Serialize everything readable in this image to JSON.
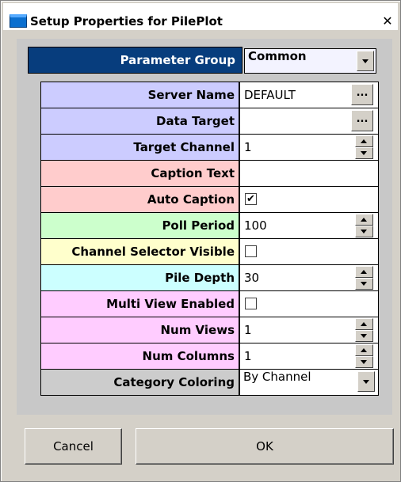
{
  "window": {
    "title": "Setup Properties for PilePlot",
    "close_glyph": "✕"
  },
  "parameter_group": {
    "label": "Parameter Group",
    "value": "Common"
  },
  "rows": [
    {
      "label": "Server Name",
      "value": "DEFAULT",
      "control": "ellipsis",
      "color": "#ccccff"
    },
    {
      "label": "Data Target",
      "value": "",
      "control": "ellipsis",
      "color": "#ccccff"
    },
    {
      "label": "Target Channel",
      "value": "1",
      "control": "spin",
      "color": "#ccccff"
    },
    {
      "label": "Caption Text",
      "value": "",
      "control": "text",
      "color": "#ffcccc"
    },
    {
      "label": "Auto Caption",
      "checked": true,
      "control": "checkbox",
      "color": "#ffcccc"
    },
    {
      "label": "Poll Period",
      "value": "100",
      "control": "spin",
      "color": "#ccffcc"
    },
    {
      "label": "Channel Selector Visible",
      "checked": false,
      "control": "checkbox",
      "color": "#ffffcc"
    },
    {
      "label": "Pile Depth",
      "value": "30",
      "control": "spin",
      "color": "#ccffff"
    },
    {
      "label": "Multi View Enabled",
      "checked": false,
      "control": "checkbox",
      "color": "#ffccff"
    },
    {
      "label": "Num Views",
      "value": "1",
      "control": "spin",
      "color": "#ffccff"
    },
    {
      "label": "Num Columns",
      "value": "1",
      "control": "spin",
      "color": "#ffccff"
    },
    {
      "label": "Category Coloring",
      "value": "By Channel",
      "control": "dropdown",
      "color": "#cccccc"
    }
  ],
  "ellipsis_glyph": "...",
  "check_glyph": "✔",
  "buttons": {
    "cancel": "Cancel",
    "ok": "OK"
  }
}
